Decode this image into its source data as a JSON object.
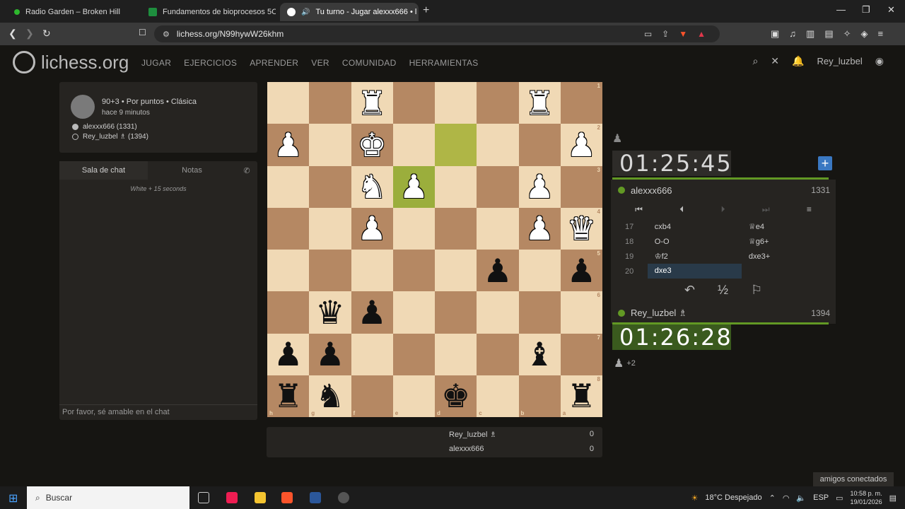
{
  "browser": {
    "tabs": [
      {
        "title": "Radio Garden – Broken Hill",
        "color": "#2eb82e"
      },
      {
        "title": "Fundamentos de bioprocesos 5C",
        "color": "#1e8e3e"
      },
      {
        "title": "Tu turno - Jugar alexxx666 • l",
        "color": "#ffffff"
      }
    ],
    "url": "lichess.org/N99hywW26khm"
  },
  "site": {
    "logo": "lichess.org",
    "nav": [
      "JUGAR",
      "EJERCICIOS",
      "APRENDER",
      "VER",
      "COMUNIDAD",
      "HERRAMIENTAS"
    ],
    "username": "Rey_luzbel"
  },
  "game": {
    "mode": "90+3 • Por puntos • Clásica",
    "when": "hace 9 minutos",
    "white_player": "alexxx666 (1331)",
    "black_player": "Rey_luzbel ♗ (1394)"
  },
  "chat": {
    "tab_chat": "Sala de chat",
    "tab_notes": "Notas",
    "message": "White + 15 seconds",
    "placeholder": "Por favor, sé amable en el chat"
  },
  "board": {
    "orientation": "black",
    "ranks": [
      "1",
      "2",
      "3",
      "4",
      "5",
      "6",
      "7",
      "8"
    ],
    "files": [
      "h",
      "g",
      "f",
      "e",
      "d",
      "c",
      "b",
      "a"
    ],
    "rows": [
      [
        "",
        "",
        "wR",
        "",
        "",
        "",
        "wR",
        ""
      ],
      [
        "wP",
        "",
        "wK",
        "",
        "",
        "",
        "",
        "wP"
      ],
      [
        "",
        "",
        "wN",
        "wP",
        "",
        "",
        "wP",
        ""
      ],
      [
        "",
        "",
        "wP",
        "",
        "",
        "",
        "wP",
        "wQ"
      ],
      [
        "",
        "",
        "",
        "",
        "",
        "bP",
        "",
        "bP"
      ],
      [
        "",
        "bQ",
        "bP",
        "",
        "",
        "",
        "",
        ""
      ],
      [
        "bP",
        "bP",
        "",
        "",
        "",
        "",
        "bB",
        ""
      ],
      [
        "bR",
        "bN",
        "",
        "",
        "bK",
        "",
        "",
        "bR"
      ]
    ],
    "highlights": [
      "e3",
      "d2"
    ]
  },
  "score": {
    "rows": [
      {
        "name": "Rey_luzbel ♗",
        "value": "0"
      },
      {
        "name": "alexxx666",
        "value": "0"
      }
    ]
  },
  "clocks": {
    "top": "01:25:45",
    "bottom": "01:26:28"
  },
  "players": {
    "top": {
      "name": "alexxx666",
      "rating": "1331"
    },
    "bottom": {
      "name": "Rey_luzbel ♗",
      "rating": "1394"
    }
  },
  "moves": [
    {
      "num": "17",
      "white": "cxb4",
      "black": "♕e4"
    },
    {
      "num": "18",
      "white": "O-O",
      "black": "♕g6+"
    },
    {
      "num": "19",
      "white": "♔f2",
      "black": "dxe3+"
    },
    {
      "num": "20",
      "white": "dxe3",
      "black": ""
    }
  ],
  "material": "+2",
  "friends": "amigos conectados",
  "taskbar": {
    "search": "Buscar",
    "weather": "18°C Despejado",
    "lang": "ESP",
    "time": "10:58 p. m.",
    "date": "19/01/2026"
  }
}
